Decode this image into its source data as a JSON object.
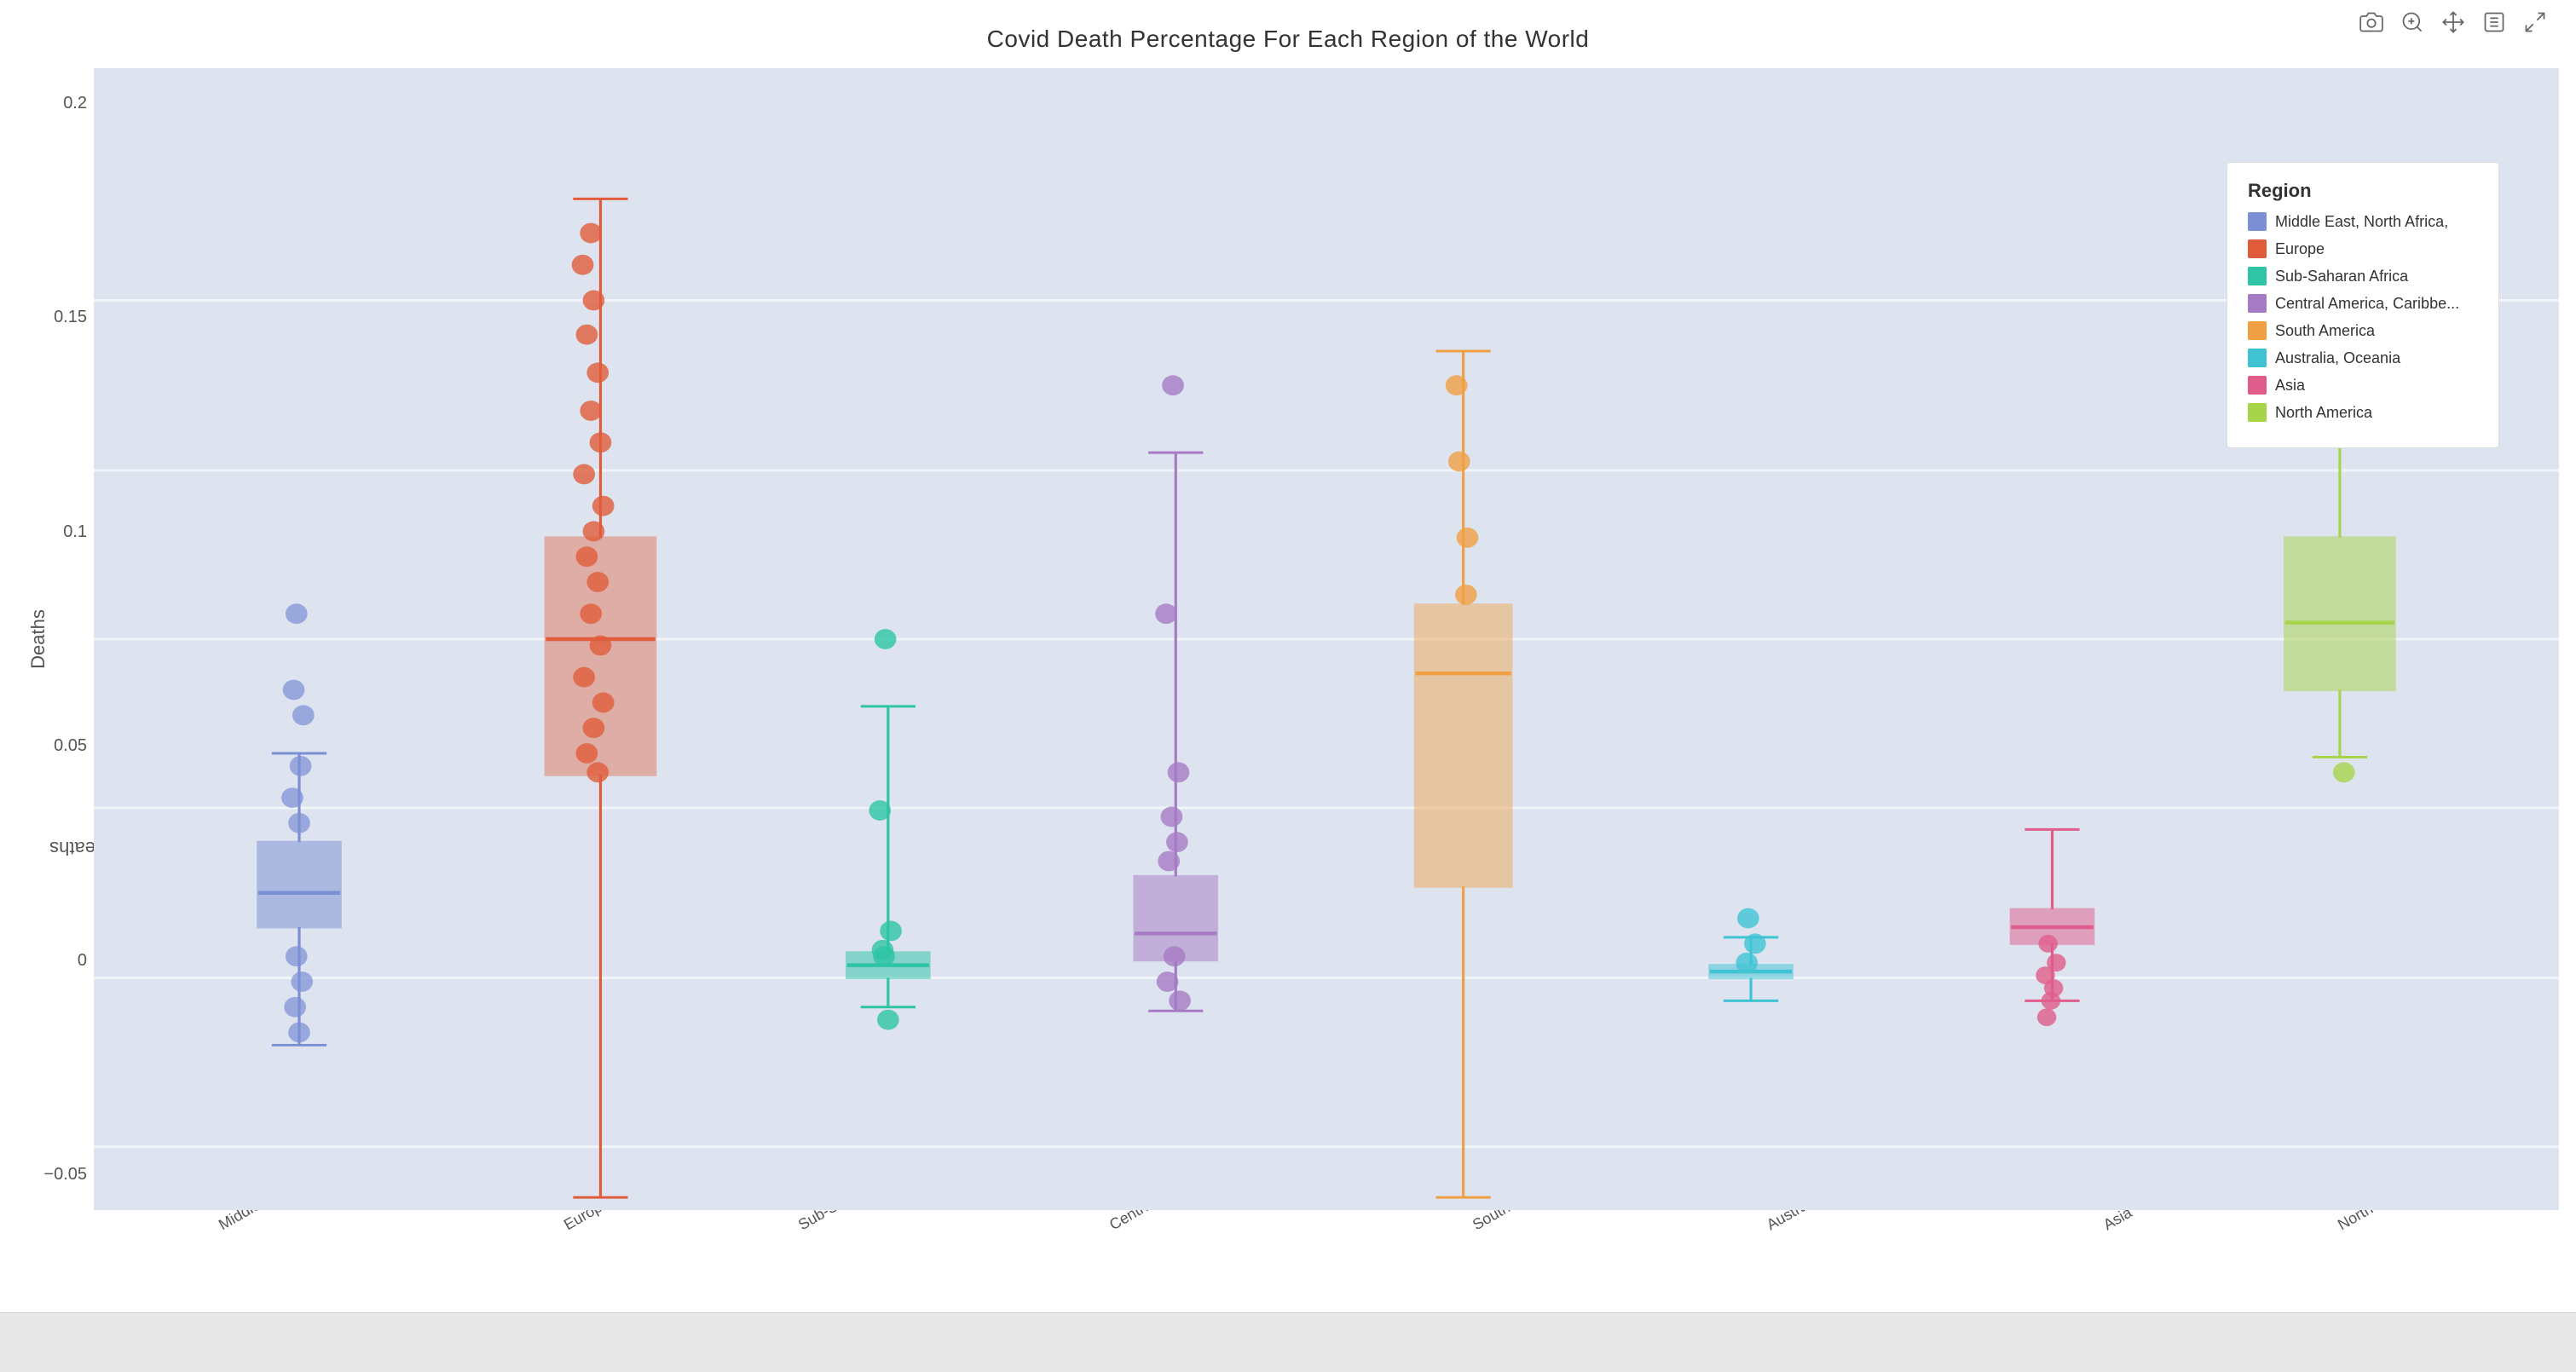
{
  "toolbar": {
    "icons": [
      "camera-icon",
      "zoom-icon",
      "pan-icon",
      "lasso-icon",
      "expand-icon"
    ]
  },
  "chart": {
    "title": "Covid Death Percentage For Each Region of the World",
    "y_axis_label": "Deaths",
    "y_ticks": [
      "-0.05",
      "0",
      "0.05",
      "0.1",
      "0.15",
      "0.2"
    ],
    "regions": [
      {
        "name": "Middle East, North Africa",
        "color": "#7b8fd4",
        "short": "Middle East, North Africa"
      },
      {
        "name": "Europe",
        "color": "#e05c3a",
        "short": "Europe"
      },
      {
        "name": "Sub-Saharan Africa",
        "color": "#2ec4a5",
        "short": "Sub-Saharan Africa"
      },
      {
        "name": "Central America, Caribbean",
        "color": "#a67bc4",
        "short": "Central America, Caribb..."
      },
      {
        "name": "South America",
        "color": "#f0a044",
        "short": "South America"
      },
      {
        "name": "Australia, Oceania",
        "color": "#40c4d4",
        "short": "Australia, Oceania"
      },
      {
        "name": "Asia",
        "color": "#e05c8a",
        "short": "Asia"
      },
      {
        "name": "North America",
        "color": "#a8d44c",
        "short": "North America"
      }
    ]
  },
  "legend": {
    "title": "Region",
    "items": [
      {
        "label": "Middle East, North Africa,",
        "color": "#7b8fd4"
      },
      {
        "label": "Europe",
        "color": "#e05c3a"
      },
      {
        "label": "Sub-Saharan Africa",
        "color": "#2ec4a5"
      },
      {
        "label": "Central America, Caribbe...",
        "color": "#a67bc4"
      },
      {
        "label": "South America",
        "color": "#f0a044"
      },
      {
        "label": "Australia, Oceania",
        "color": "#40c4d4"
      },
      {
        "label": "Asia",
        "color": "#e05c8a"
      },
      {
        "label": "North America",
        "color": "#a8d44c"
      }
    ]
  }
}
